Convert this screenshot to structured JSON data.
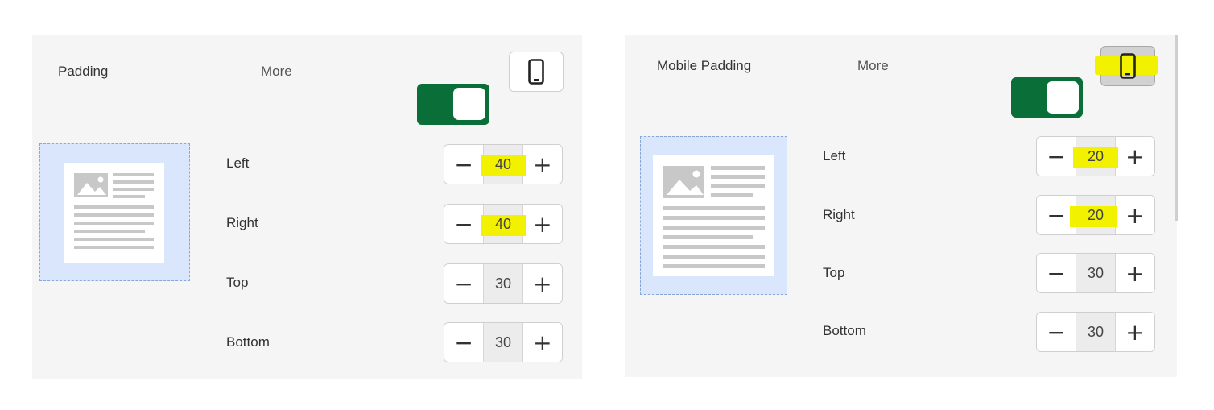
{
  "left_panel": {
    "title": "Padding",
    "more_label": "More",
    "device_icon": "mobile-phone-icon",
    "toggle_on": true,
    "rows": [
      {
        "label": "Left",
        "value": "40",
        "minus": "−",
        "plus": "+"
      },
      {
        "label": "Right",
        "value": "40",
        "minus": "−",
        "plus": "+"
      },
      {
        "label": "Top",
        "value": "30",
        "minus": "−",
        "plus": "+"
      },
      {
        "label": "Bottom",
        "value": "30",
        "minus": "−",
        "plus": "+"
      }
    ]
  },
  "right_panel": {
    "title": "Mobile Padding",
    "more_label": "More",
    "device_icon": "mobile-phone-icon",
    "device_active": true,
    "toggle_on": true,
    "rows": [
      {
        "label": "Left",
        "value": "20",
        "minus": "−",
        "plus": "+"
      },
      {
        "label": "Right",
        "value": "20",
        "minus": "−",
        "plus": "+"
      },
      {
        "label": "Top",
        "value": "30",
        "minus": "−",
        "plus": "+"
      },
      {
        "label": "Bottom",
        "value": "30",
        "minus": "−",
        "plus": "+"
      }
    ]
  },
  "colors": {
    "toggle_green": "#0a6e38",
    "highlight_yellow": "#f2f200",
    "preview_blue": "#d9e6fb",
    "panel_bg": "#f5f5f5"
  }
}
